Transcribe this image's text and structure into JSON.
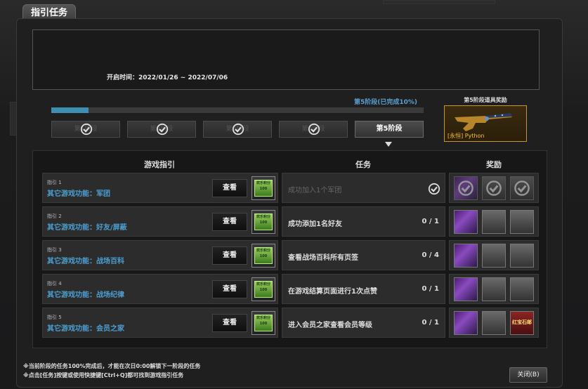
{
  "window": {
    "title": "指引任务"
  },
  "info": {
    "open_time": "开启时间：2022/01/26 ~ 2022/07/06"
  },
  "progress": {
    "stage_text": "第5阶段(已完成10%)",
    "percent": 10
  },
  "stages": [
    {
      "label": "第1阶段",
      "completed": true,
      "active": false
    },
    {
      "label": "第2阶段",
      "completed": true,
      "active": false
    },
    {
      "label": "第3阶段",
      "completed": true,
      "active": false
    },
    {
      "label": "第4阶段",
      "completed": true,
      "active": false
    },
    {
      "label": "第5阶段",
      "completed": false,
      "active": true
    }
  ],
  "stage_reward": {
    "title": "第5阶段道具奖励",
    "item_label": "[永恒] Python",
    "icon": "revolver-icon"
  },
  "table": {
    "headers": {
      "guide": "游戏指引",
      "task": "任务",
      "reward": "奖励"
    },
    "view_label": "查看",
    "guide_item_text": "欢乐积分 100",
    "rows": [
      {
        "num": "指引 1",
        "name": "其它游戏功能：军团",
        "task": "成功加入1个军团",
        "count": "",
        "done": true,
        "rewards": [
          "purple",
          "grey",
          "grey"
        ],
        "reward_labels": [
          "",
          "",
          ""
        ]
      },
      {
        "num": "指引 2",
        "name": "其它游戏功能：好友/屏蔽",
        "task": "成功添加1名好友",
        "count": "0 / 1",
        "done": false,
        "rewards": [
          "purple",
          "grey",
          "grey"
        ],
        "reward_labels": [
          "",
          "",
          ""
        ]
      },
      {
        "num": "指引 3",
        "name": "其它游戏功能：战场百科",
        "task": "查看战场百科所有页签",
        "count": "0 / 4",
        "done": false,
        "rewards": [
          "purple",
          "grey",
          "grey"
        ],
        "reward_labels": [
          "",
          "",
          ""
        ]
      },
      {
        "num": "指引 4",
        "name": "其它游戏功能：战场纪律",
        "task": "在游戏结算页面进行1次点赞",
        "count": "0 / 1",
        "done": false,
        "rewards": [
          "purple",
          "grey",
          "grey"
        ],
        "reward_labels": [
          "",
          "",
          ""
        ]
      },
      {
        "num": "指引 5",
        "name": "其它游戏功能：会员之家",
        "task": "进入会员之家查看会员等级",
        "count": "0 / 1",
        "done": false,
        "rewards": [
          "purple",
          "grey",
          "red"
        ],
        "reward_labels": [
          "",
          "",
          "红宝石邮"
        ]
      }
    ]
  },
  "footer": {
    "note1": "※当前阶段的任务100%完成后，才能在次日0:00解锁下一阶段的任务",
    "note2": "※点击[任务]按键或使用快捷键[Ctrl+Q]都可找到游戏指引任务",
    "close_label": "关闭(B)"
  },
  "colors": {
    "accent": "#3f8fb5",
    "guide_name": "#4b9fd0",
    "gold": "#c8961c"
  }
}
